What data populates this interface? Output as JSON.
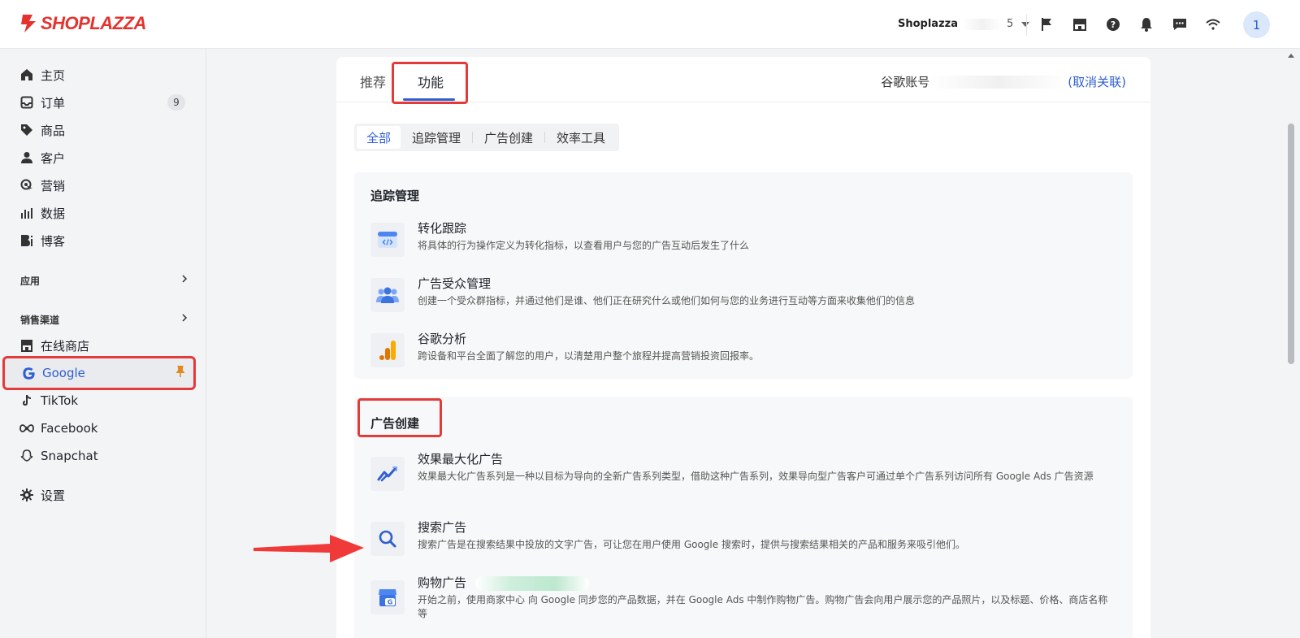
{
  "topbar": {
    "logo_text": "SHOPLAZZA",
    "store_name": "Shoplazza",
    "store_suffix": "5",
    "avatar_text": "1"
  },
  "sidebar": {
    "items": [
      {
        "label": "主页",
        "icon": "home-icon"
      },
      {
        "label": "订单",
        "icon": "inbox-icon",
        "badge": "9"
      },
      {
        "label": "商品",
        "icon": "tag-icon"
      },
      {
        "label": "客户",
        "icon": "person-icon"
      },
      {
        "label": "营销",
        "icon": "target-icon"
      },
      {
        "label": "数据",
        "icon": "bar-chart-icon"
      },
      {
        "label": "博客",
        "icon": "blog-icon"
      }
    ],
    "apps_label": "应用",
    "channels_label": "销售渠道",
    "channels": [
      {
        "label": "在线商店",
        "icon": "store-icon"
      },
      {
        "label": "Google",
        "icon": "google-icon"
      },
      {
        "label": "TikTok",
        "icon": "tiktok-icon"
      },
      {
        "label": "Facebook",
        "icon": "meta-icon"
      },
      {
        "label": "Snapchat",
        "icon": "snapchat-icon"
      }
    ],
    "settings_label": "设置"
  },
  "main": {
    "tabs": [
      {
        "label": "推荐"
      },
      {
        "label": "功能"
      }
    ],
    "account_label": "谷歌账号",
    "account_link": "(取消关联)",
    "filters": [
      "全部",
      "追踪管理",
      "广告创建",
      "效率工具"
    ],
    "sections": [
      {
        "title": "追踪管理",
        "features": [
          {
            "title": "转化跟踪",
            "desc": "将具体的行为操作定义为转化指标，以查看用户与您的广告互动后发生了什么"
          },
          {
            "title": "广告受众管理",
            "desc": "创建一个受众群指标，并通过他们是谁、他们正在研究什么或他们如何与您的业务进行互动等方面来收集他们的信息"
          },
          {
            "title": "谷歌分析",
            "desc": "跨设备和平台全面了解您的用户，以清楚用户整个旅程并提高营销投资回报率。"
          }
        ]
      },
      {
        "title": "广告创建",
        "features": [
          {
            "title": "效果最大化广告",
            "desc": "效果最大化广告系列是一种以目标为导向的全新广告系列类型，借助这种广告系列，效果导向型广告客户可通过单个广告系列访问所有 Google Ads 广告资源"
          },
          {
            "title": "搜索广告",
            "desc": "搜索广告是在搜索结果中投放的文字广告，可让您在用户使用 Google 搜索时，提供与搜索结果相关的产品和服务来吸引他们。"
          },
          {
            "title": "购物广告",
            "desc": "开始之前，使用商家中心 向 Google 同步您的产品数据，并在 Google Ads 中制作购物广告。购物广告会向用户展示您的产品照片，以及标题、价格、商店名称等"
          }
        ]
      }
    ]
  },
  "colors": {
    "accent": "#2f5fd0",
    "brand": "#e4322f",
    "highlight": "#e53a3a"
  }
}
